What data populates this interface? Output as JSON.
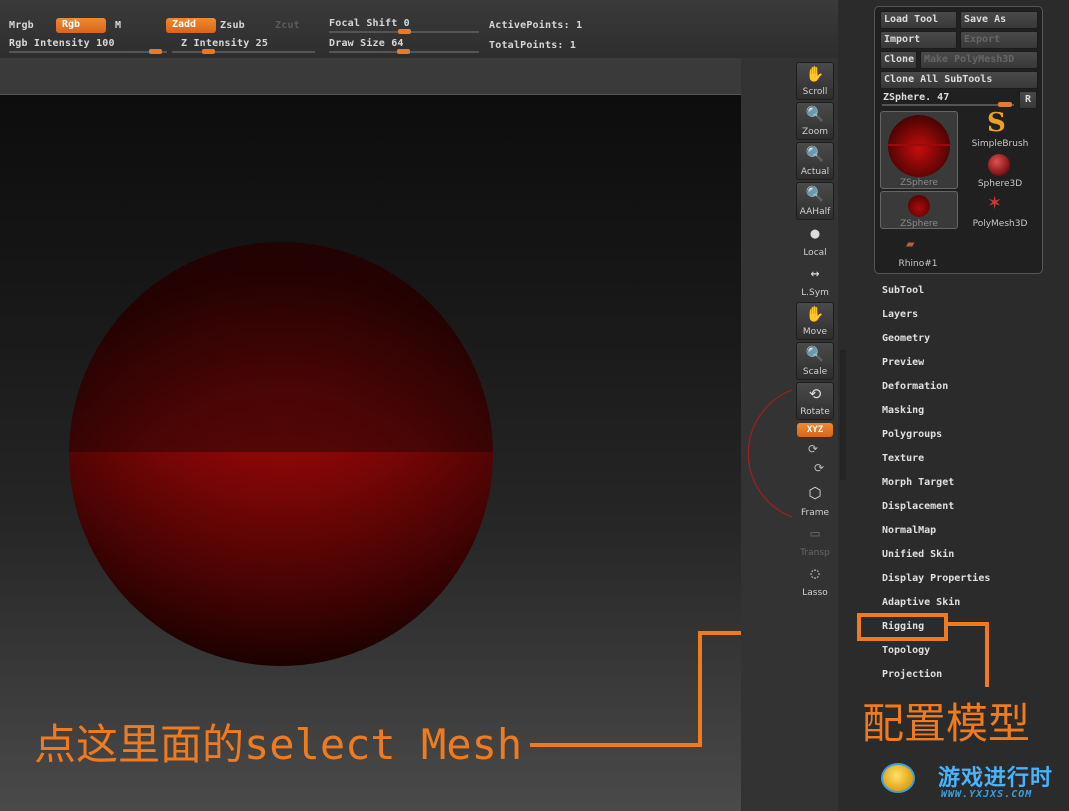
{
  "topbar": {
    "mrgb": "Mrgb",
    "rgb": "Rgb",
    "m": "M",
    "zadd": "Zadd",
    "zsub": "Zsub",
    "zcut": "Zcut",
    "rgb_intensity": "Rgb Intensity 100",
    "z_intensity": "Z Intensity 25",
    "focal_shift": "Focal Shift 0",
    "draw_size": "Draw Size 64",
    "active_points": "ActivePoints: 1",
    "total_points": "TotalPoints: 1"
  },
  "right_toolbar": [
    {
      "label": "Scroll",
      "icon": "hand-icon"
    },
    {
      "label": "Zoom",
      "icon": "magnifier-icon"
    },
    {
      "label": "Actual",
      "icon": "magnifier-icon"
    },
    {
      "label": "AAHalf",
      "icon": "magnifier-icon"
    },
    {
      "label": "Local",
      "icon": "sphere-icon"
    },
    {
      "label": "L.Sym",
      "icon": "symmetry-icon"
    },
    {
      "label": "Move",
      "icon": "hand-icon"
    },
    {
      "label": "Scale",
      "icon": "magnifier-icon"
    },
    {
      "label": "Rotate",
      "icon": "rotate-icon"
    },
    {
      "label": "Frame",
      "icon": "cube-icon"
    },
    {
      "label": "Transp",
      "icon": "layers-icon"
    },
    {
      "label": "Lasso",
      "icon": "lasso-icon"
    }
  ],
  "xyz_label": "XYZ",
  "tool_popup": {
    "load_tool": "Load Tool",
    "save_as": "Save As",
    "import": "Import",
    "export": "Export",
    "clone": "Clone",
    "make_polymesh": "Make PolyMesh3D",
    "clone_all": "Clone All SubTools",
    "zsphere_slider": "ZSphere. 47",
    "r_button": "R",
    "tools": [
      "ZSphere",
      "SimpleBrush",
      "Sphere3D",
      "ZSphere",
      "PolyMesh3D",
      "Rhino#1"
    ]
  },
  "menu_items": [
    "SubTool",
    "Layers",
    "Geometry",
    "Preview",
    "Deformation",
    "Masking",
    "Polygroups",
    "Texture",
    "Morph Target",
    "Displacement",
    "NormalMap",
    "Unified Skin",
    "Display Properties",
    "Adaptive Skin",
    "Rigging",
    "Topology",
    "Projection"
  ],
  "annotations": {
    "left_text": "点这里面的select Mesh",
    "right_text": "配置模型",
    "accent_color": "#f07b1f"
  },
  "watermark": {
    "title": "游戏进行时",
    "url": "WWW.YXJXS.COM"
  }
}
